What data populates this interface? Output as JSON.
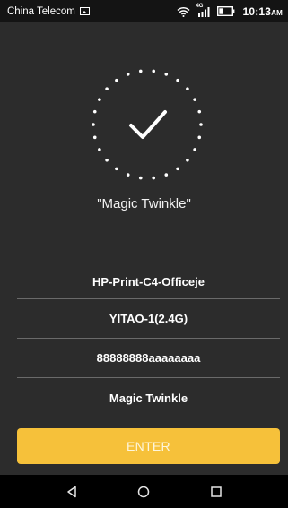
{
  "status_bar": {
    "carrier": "China Telecom",
    "network_type": "4G",
    "time": "10:13",
    "time_suffix": "AM"
  },
  "success": {
    "ssid_title": "\"Magic Twinkle\""
  },
  "networks": [
    {
      "label": "HP-Print-C4-Officeje"
    },
    {
      "label": "YITAO-1(2.4G)"
    },
    {
      "label": "88888888aaaaaaaa"
    },
    {
      "label": "Magic Twinkle"
    }
  ],
  "enter_button": {
    "label": "ENTER"
  },
  "colors": {
    "background": "#2c2c2c",
    "accent": "#f6c13a",
    "status_bar": "#141414",
    "nav_bar": "#000000"
  },
  "icons": {
    "status": [
      "gallery-icon",
      "wifi-icon",
      "signal-icon",
      "battery-icon"
    ],
    "nav": [
      "back-icon",
      "home-icon",
      "recents-icon"
    ],
    "main": "checkmark-icon"
  }
}
